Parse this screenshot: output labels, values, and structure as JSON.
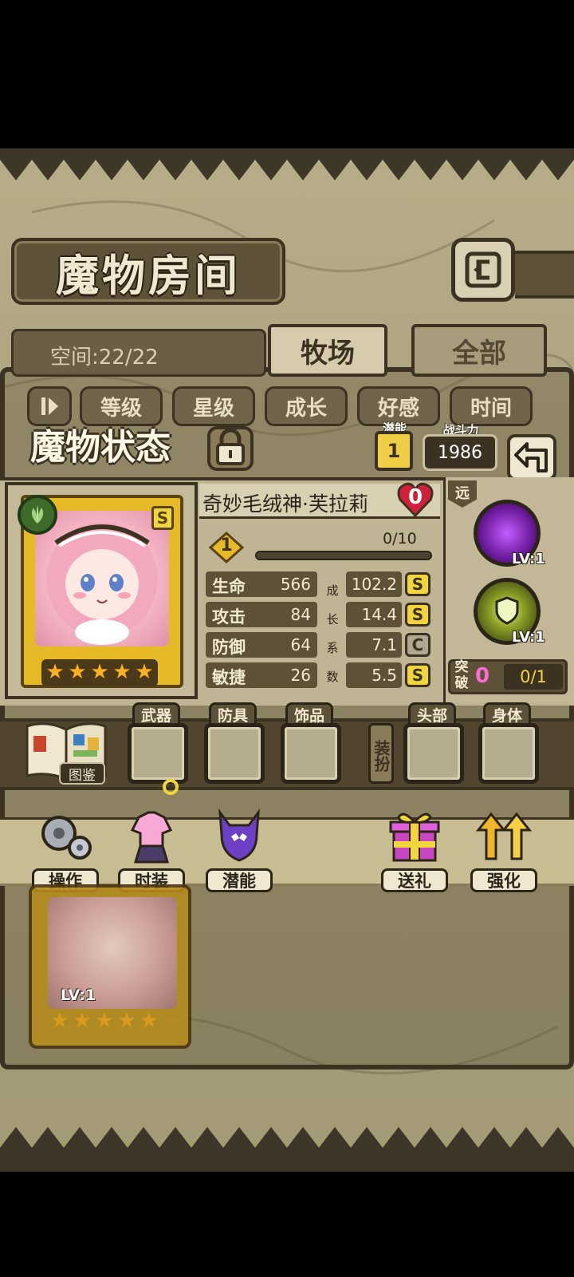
{
  "header": {
    "title": "魔物房间",
    "space_label": "空间:22/22",
    "tabs": [
      {
        "label": "牧场",
        "selected": true
      },
      {
        "label": "全部",
        "selected": false
      }
    ]
  },
  "sort_buttons": [
    "等级",
    "星级",
    "成长",
    "好感",
    "时间"
  ],
  "status": {
    "title": "魔物状态",
    "potential_label": "潜能",
    "potential_value": "1",
    "power_label": "战斗力",
    "power_value": "1986"
  },
  "monster": {
    "name": "奇妙毛绒神·芙拉莉",
    "affection": "0",
    "rank": "S",
    "level": "1",
    "exp_text": "0/10",
    "exp_fraction": 0,
    "stars": 5,
    "stats": [
      {
        "label": "生命",
        "value": "566",
        "growth": "102.2",
        "grade": "S"
      },
      {
        "label": "攻击",
        "value": "84",
        "growth": "14.4",
        "grade": "S"
      },
      {
        "label": "防御",
        "value": "64",
        "growth": "7.1",
        "grade": "C"
      },
      {
        "label": "敏捷",
        "value": "26",
        "growth": "5.5",
        "grade": "S"
      }
    ],
    "growth_label_chars": [
      "成",
      "长",
      "系",
      "数"
    ]
  },
  "skills": {
    "range_label": "远",
    "skill1_level": "LV:1",
    "skill2_level": "LV:1",
    "break_label": "突破",
    "break_value": "0",
    "break_count": "0/1"
  },
  "equipment": {
    "book_label": "图鉴",
    "weapon": "武器",
    "armor": "防具",
    "accessory": "饰品",
    "pickup_label": "装扮",
    "head": "头部",
    "body": "身体"
  },
  "actions": {
    "operate": "操作",
    "costume": "时装",
    "potential": "潜能",
    "gift": "送礼",
    "enhance": "强化"
  },
  "mini_card": {
    "level": "LV:1",
    "stars": 5
  },
  "colors": {
    "parchment": "#b7ad88",
    "dark_brown": "#3b3222",
    "gold": "#e6b927",
    "grade_s": "#f2d53a"
  }
}
